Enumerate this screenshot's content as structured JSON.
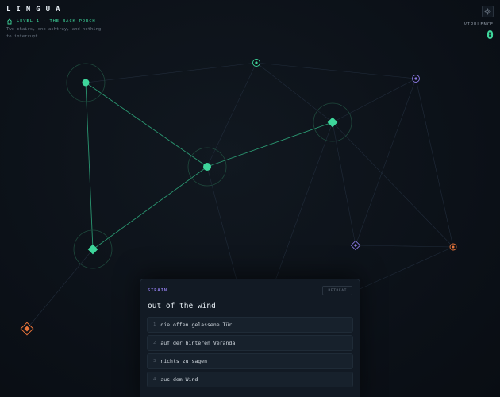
{
  "app": {
    "title": "LINGUA"
  },
  "level": {
    "label": "LEVEL 1 · THE BACK PORCH"
  },
  "subtitle": "Two chairs, one ashtray, and nothing to interrupt.",
  "virulence": {
    "label": "VIRULENCE",
    "value": "0"
  },
  "colors": {
    "accent": "#3ed69b",
    "purple": "#8a78e0",
    "orange": "#e8743a",
    "background": "#0c1118"
  },
  "icons": {
    "settings": "gear-icon",
    "level": "home-icon"
  },
  "panel": {
    "label": "STRAIN",
    "retreat_label": "RETREAT",
    "prompt": "out of the wind",
    "options": [
      {
        "num": "1",
        "text": "die offen gelassene Tür"
      },
      {
        "num": "2",
        "text": "auf der hinteren Veranda"
      },
      {
        "num": "3",
        "text": "nichts zu sagen"
      },
      {
        "num": "4",
        "text": "aus dem Wind"
      }
    ]
  }
}
